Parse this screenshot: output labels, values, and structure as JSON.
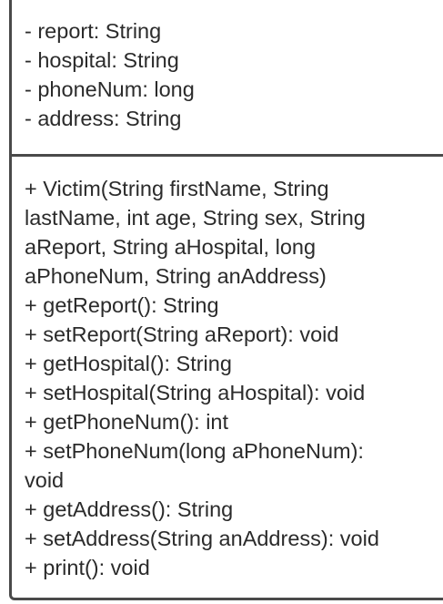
{
  "attributes": [
    "- report: String",
    "- hospital: String",
    "- phoneNum: long",
    "- address: String"
  ],
  "methods": [
    "+ Victim(String firstName, String",
    "lastName, int age, String sex, String",
    "aReport, String aHospital, long",
    "aPhoneNum, String anAddress)",
    "+ getReport(): String",
    "+ setReport(String aReport): void",
    "+ getHospital(): String",
    "+ setHospital(String aHospital): void",
    "+ getPhoneNum(): int",
    "+ setPhoneNum(long aPhoneNum):",
    "void",
    "+ getAddress(): String",
    "+ setAddress(String anAddress): void",
    "+ print(): void"
  ]
}
